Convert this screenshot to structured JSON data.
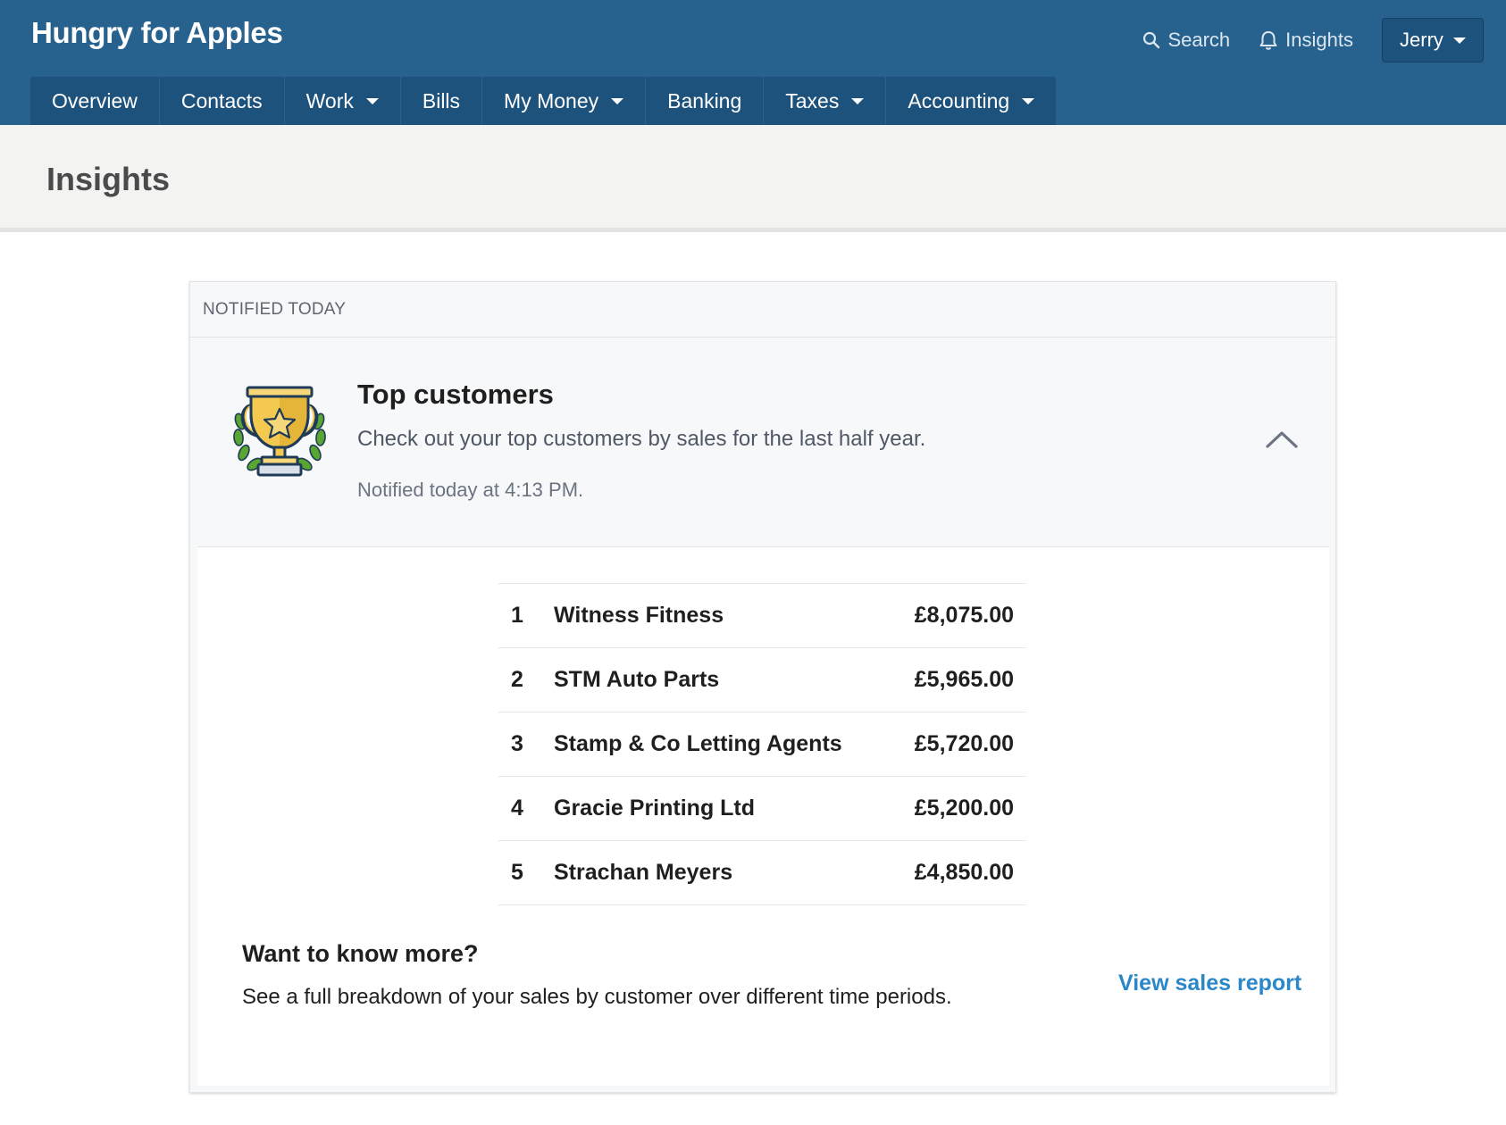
{
  "header": {
    "brand": "Hungry for Apples",
    "search_label": "Search",
    "insights_label": "Insights",
    "user_name": "Jerry"
  },
  "nav": {
    "items": [
      {
        "label": "Overview",
        "has_dropdown": false
      },
      {
        "label": "Contacts",
        "has_dropdown": false
      },
      {
        "label": "Work",
        "has_dropdown": true
      },
      {
        "label": "Bills",
        "has_dropdown": false
      },
      {
        "label": "My Money",
        "has_dropdown": true
      },
      {
        "label": "Banking",
        "has_dropdown": false
      },
      {
        "label": "Taxes",
        "has_dropdown": true
      },
      {
        "label": "Accounting",
        "has_dropdown": true
      }
    ]
  },
  "page": {
    "title": "Insights"
  },
  "card": {
    "section_label": "NOTIFIED TODAY",
    "icon": "trophy-icon",
    "title": "Top customers",
    "description": "Check out your top customers by sales for the last half year.",
    "notified": "Notified today at 4:13 PM.",
    "customers": [
      {
        "rank": "1",
        "name": "Witness Fitness",
        "amount": "£8,075.00"
      },
      {
        "rank": "2",
        "name": "STM Auto Parts",
        "amount": "£5,965.00"
      },
      {
        "rank": "3",
        "name": "Stamp & Co Letting Agents",
        "amount": "£5,720.00"
      },
      {
        "rank": "4",
        "name": "Gracie Printing Ltd",
        "amount": "£5,200.00"
      },
      {
        "rank": "5",
        "name": "Strachan Meyers",
        "amount": "£4,850.00"
      }
    ],
    "more_title": "Want to know more?",
    "more_description": "See a full breakdown of your sales by customer over different time periods.",
    "report_link": "View sales report"
  },
  "colors": {
    "header_bg": "#27628f",
    "nav_bg": "#1d527d",
    "link": "#2a87c8",
    "trophy_gold": "#f3c94f",
    "trophy_leaf": "#5aa632"
  }
}
